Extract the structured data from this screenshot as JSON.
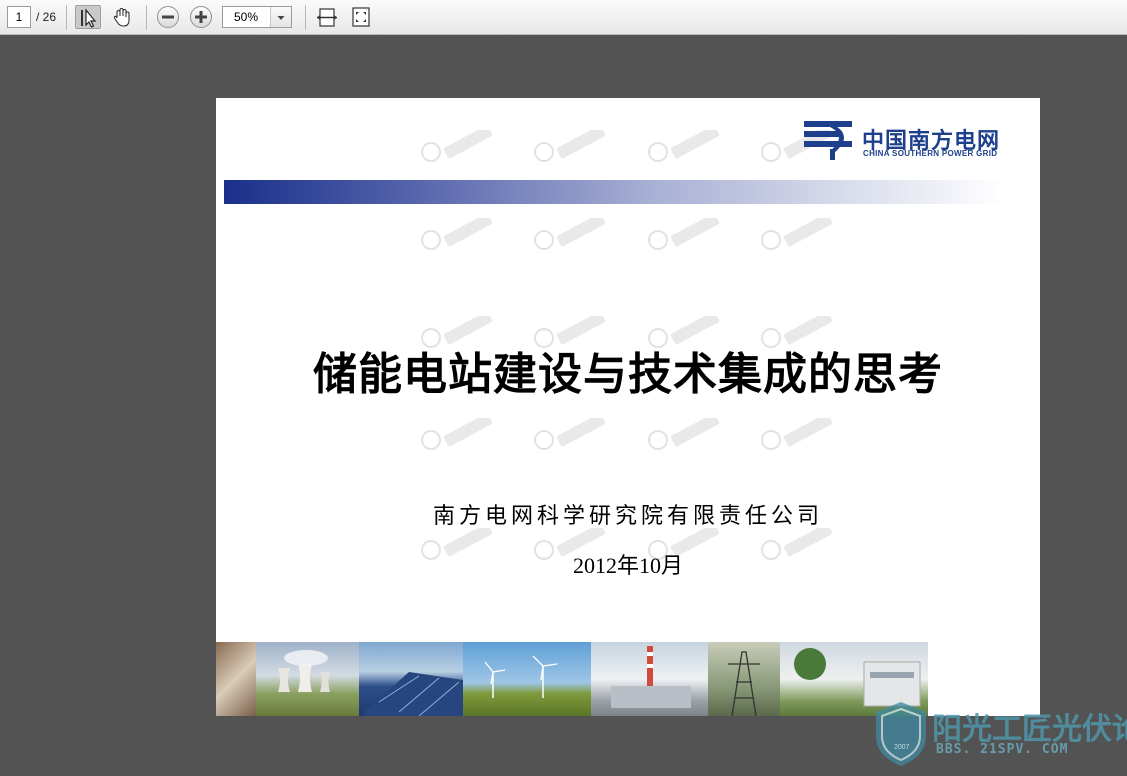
{
  "toolbar": {
    "page_current": "1",
    "page_total": "/ 26",
    "zoom_value": "50%",
    "icons": [
      "select-tool-icon",
      "hand-tool-icon",
      "zoom-out-icon",
      "zoom-in-icon",
      "zoom-dropdown-icon",
      "fit-width-icon",
      "fit-page-icon"
    ]
  },
  "document": {
    "logo_cn": "中国南方电网",
    "logo_en": "CHINA SOUTHERN POWER GRID",
    "title": "储能电站建设与技术集成的思考",
    "organization": "南方电网科学研究院有限责任公司",
    "date": "2012年10月"
  },
  "overlay": {
    "forum_name": "阳光工匠光伏论坛",
    "forum_url": "BBS. 21SPV. COM",
    "forum_year": "2007"
  },
  "colors": {
    "brand_blue": "#1d3f8c",
    "viewer_background": "#535353"
  }
}
